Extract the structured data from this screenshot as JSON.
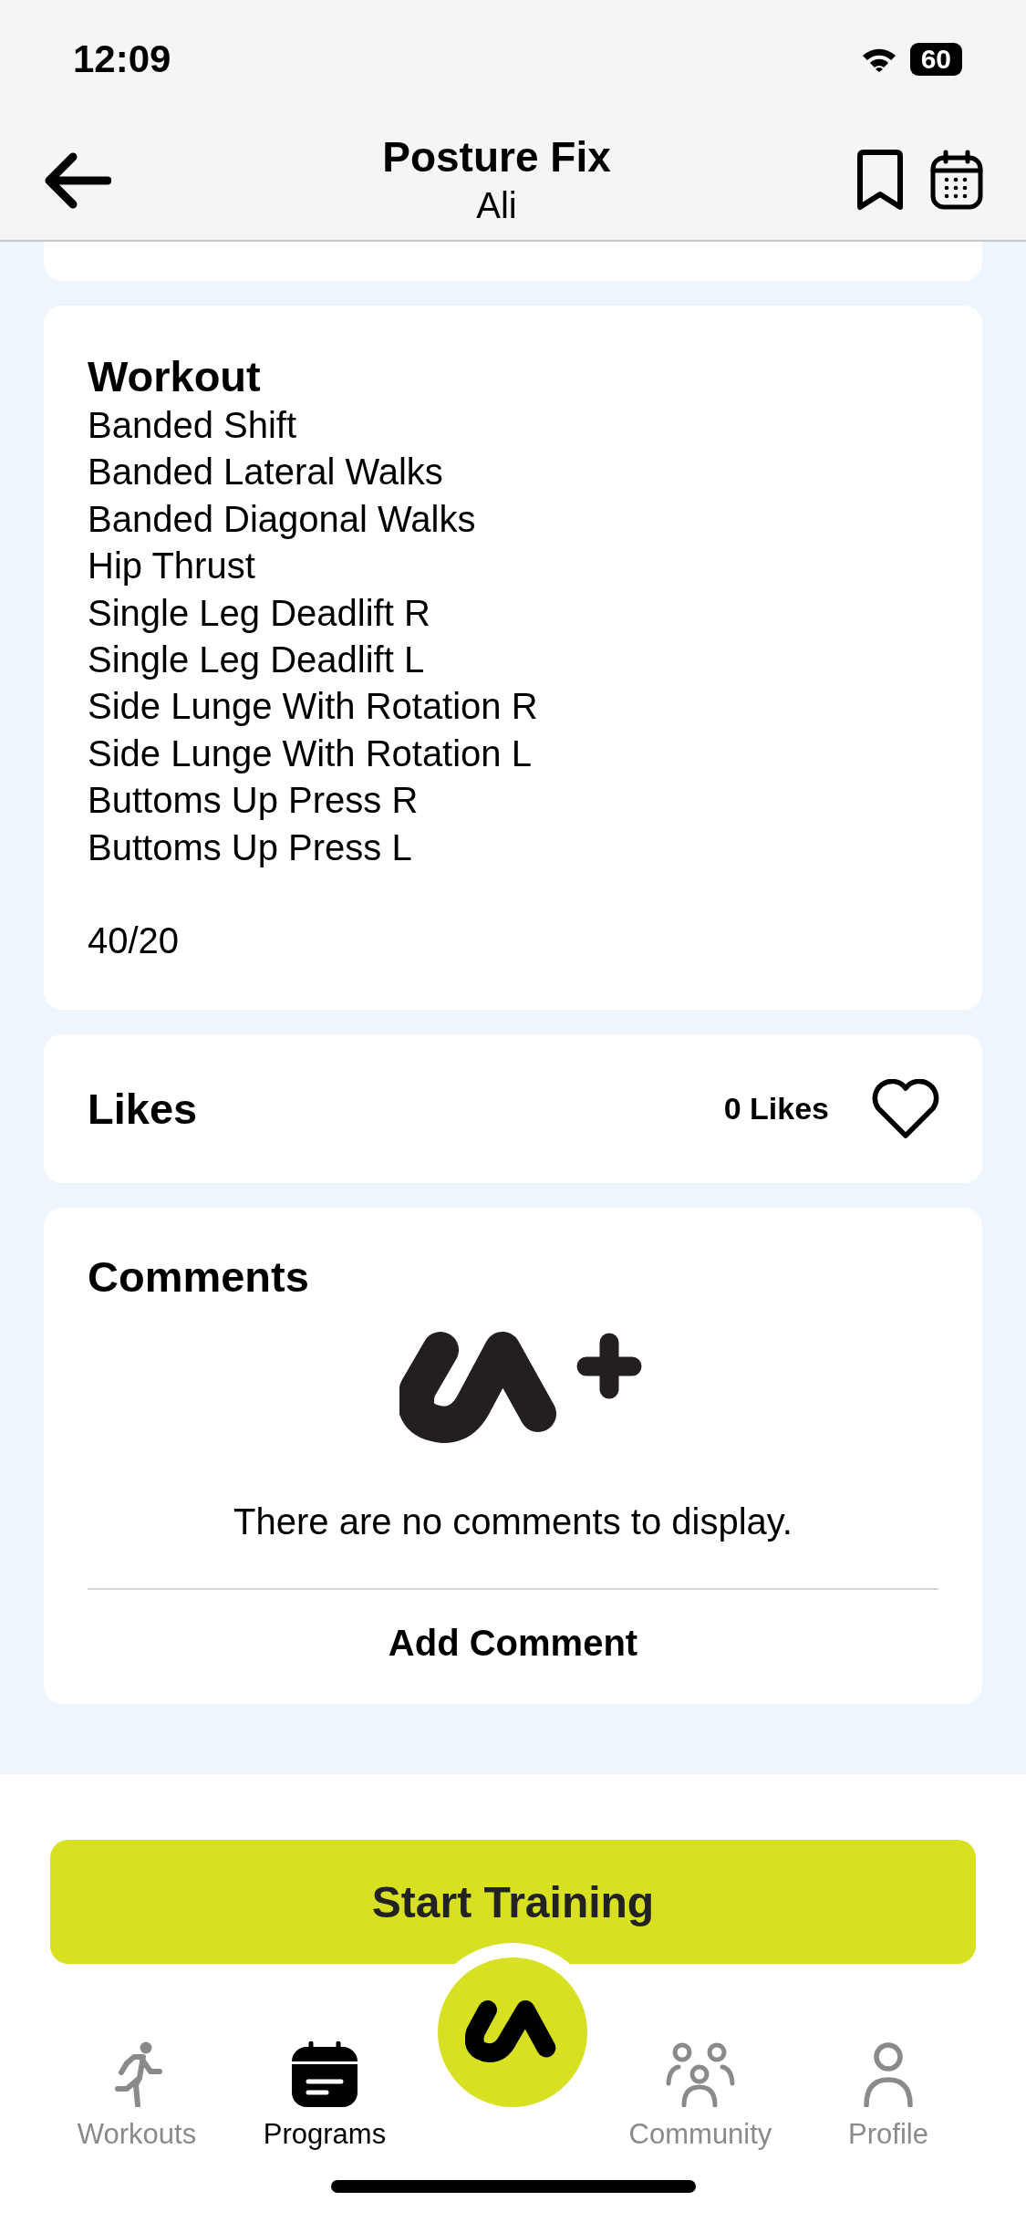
{
  "status_bar": {
    "time": "12:09",
    "battery": "60"
  },
  "header": {
    "title": "Posture Fix",
    "subtitle": "Ali"
  },
  "workout": {
    "title": "Workout",
    "exercises": [
      "Banded Shift",
      "Banded Lateral Walks",
      "Banded Diagonal Walks",
      "Hip Thrust",
      "Single Leg Deadlift R",
      "Single Leg Deadlift L",
      "Side Lunge With Rotation R",
      "Side Lunge With Rotation L",
      "Buttoms Up Press R",
      "Buttoms Up Press L"
    ],
    "note": "40/20"
  },
  "likes": {
    "title": "Likes",
    "count": "0 Likes"
  },
  "comments": {
    "title": "Comments",
    "empty_message": "There are no comments to display.",
    "add_label": "Add Comment"
  },
  "start_button": "Start Training",
  "tabs": [
    {
      "label": "Workouts",
      "selected": false
    },
    {
      "label": "Programs",
      "selected": true
    },
    {
      "label": "Community",
      "selected": false
    },
    {
      "label": "Profile",
      "selected": false
    }
  ]
}
